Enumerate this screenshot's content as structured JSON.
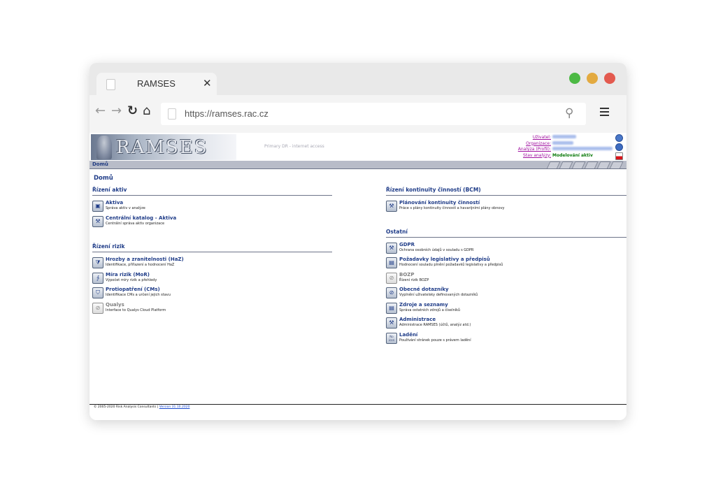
{
  "browser": {
    "tab_title": "RAMSES",
    "close_glyph": "✕",
    "url": "https://ramses.rac.cz",
    "window_dots": [
      "#4cb944",
      "#e3aa40",
      "#e35a4f"
    ]
  },
  "header": {
    "logo_text": "RAMSES",
    "access_note": "Primary DR - internet access",
    "labels": {
      "user": "Uživatel:",
      "organization": "Organizace:",
      "analysis": "Analýza (Profil):",
      "analysis_state": "Stav analýzy:"
    },
    "analysis_state_value": "Modelování aktiv"
  },
  "breadcrumb": {
    "label": "Domů"
  },
  "main": {
    "page_title": "Domů",
    "left": [
      {
        "heading": "Řízení aktiv",
        "items": [
          {
            "name": "Aktiva",
            "desc": "Správa aktiv v analýze",
            "icon": "box-icon",
            "glyph": "▣"
          },
          {
            "name": "Centrální katalog - Aktiva",
            "desc": "Centrální správa aktiv organizace",
            "icon": "tools-icon",
            "glyph": "⚒"
          }
        ]
      },
      {
        "heading": "Řízení rizik",
        "items": [
          {
            "name": "Hrozby a zranitelnosti (HaZ)",
            "desc": "Identifikace, přiřazení a hodnocení HaZ",
            "icon": "funnel-icon",
            "glyph": "⧩"
          },
          {
            "name": "Míra rizik (MoR)",
            "desc": "Výpočet míry rizik a přehledy",
            "icon": "measure-icon",
            "glyph": "∱"
          },
          {
            "name": "Protiopatření (CMs)",
            "desc": "Identifikace CMs a určení jejich stavu",
            "icon": "shield-icon",
            "glyph": "⛉"
          },
          {
            "name": "Qualys",
            "desc": "Interface to Qualys Cloud Platform",
            "icon": "disabled-icon",
            "glyph": "⊘",
            "disabled": true
          }
        ]
      }
    ],
    "right": [
      {
        "heading": "Řízení kontinuity činností (BCM)",
        "items": [
          {
            "name": "Plánování kontinuity činností",
            "desc": "Práce s plány kontinuity činností a havarijními plány obnovy",
            "icon": "tools-icon",
            "glyph": "⚒"
          }
        ]
      },
      {
        "heading": "Ostatní",
        "items": [
          {
            "name": "GDPR",
            "desc": "Ochrana osobních údajů v souladu s GDPR",
            "icon": "tools-icon",
            "glyph": "⚒"
          },
          {
            "name": "Požadavky legislativy a předpisů",
            "desc": "Hodnocení souladu plnění požadavků legislativy a předpisů",
            "icon": "document-icon",
            "glyph": "▤"
          },
          {
            "name": "BOZP",
            "desc": "Řízení rizik BOZP",
            "icon": "disabled-icon",
            "glyph": "⊘",
            "disabled": true
          },
          {
            "name": "Obecné dotazníky",
            "desc": "Vyplnění uživatelsky definovaných dotazníků",
            "icon": "disabled-icon",
            "glyph": "⊘"
          },
          {
            "name": "Zdroje a seznamy",
            "desc": "Správa ostatních zdrojů a číselníků",
            "icon": "list-icon",
            "glyph": "▤"
          },
          {
            "name": "Administrace",
            "desc": "Administrace RAMSES (účtů, analýz atd.)",
            "icon": "tools-icon",
            "glyph": "⚒"
          },
          {
            "name": "Ladění",
            "desc": "Používání stránek pouze s právem ladění",
            "icon": "noicon-icon",
            "glyph": "No icon",
            "noicon": true
          }
        ]
      }
    ]
  },
  "footer": {
    "copyright": "© 2005-2020 Risk Analysis Consultants |",
    "version": "Version 31.10.2020"
  }
}
